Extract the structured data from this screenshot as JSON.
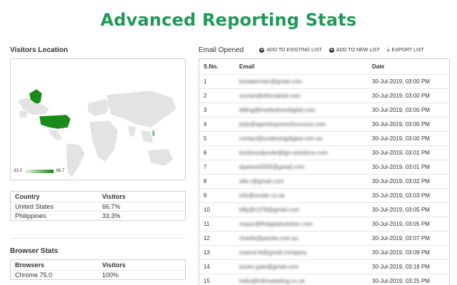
{
  "title": "Advanced Reporting Stats",
  "visitors_location": {
    "heading": "Visitors Location",
    "legend_min": "33.3",
    "legend_max": "66.7",
    "highlight_color": "#1a8a1a"
  },
  "country_table": {
    "headers": [
      "Country",
      "Visitors"
    ],
    "rows": [
      [
        "United States",
        "66.7%"
      ],
      [
        "Philippines",
        "33.3%"
      ]
    ]
  },
  "browser_stats": {
    "heading": "Browser Stats",
    "headers": [
      "Browsers",
      "Visitors"
    ],
    "rows": [
      [
        "Chrome 75.0",
        "100%"
      ]
    ]
  },
  "email_opened": {
    "heading": "Email Opened",
    "actions": [
      "ADD TO EXISTING LIST",
      "ADD TO NEW LIST",
      "EXPORT LIST"
    ],
    "headers": [
      "S.No.",
      "Email",
      "Date"
    ],
    "rows": [
      [
        "1",
        "kowaterman@gmail.com",
        "30-Jul-2019, 03:00 PM"
      ],
      [
        "2",
        "suvran@ethicalead.com",
        "30-Jul-2019, 03:00 PM"
      ],
      [
        "3",
        "billing@insidedivesdigital.com",
        "30-Jul-2019, 03:00 PM"
      ],
      [
        "4",
        "jody@agentexpress2success.com",
        "30-Jul-2019, 03:00 PM"
      ],
      [
        "5",
        "contact@underdogdigital.com.au",
        "30-Jul-2019, 03:00 PM"
      ],
      [
        "6",
        "koolsooulpoole@ign-solutions.com",
        "30-Jul-2019, 03:01 PM"
      ],
      [
        "7",
        "dpalmer0000@gmail.com",
        "30-Jul-2019, 03:01 PM"
      ],
      [
        "8",
        "atle.r@gmail.com",
        "30-Jul-2019, 03:02 PM"
      ],
      [
        "9",
        "info@onsite.co.uk",
        "30-Jul-2019, 03:03 PM"
      ],
      [
        "10",
        "billy@1378@gmail.com",
        "30-Jul-2019, 03:05 PM"
      ],
      [
        "11",
        "mayur@fhdigitalsolution.com",
        "30-Jul-2019, 03:05 PM"
      ],
      [
        "12",
        "charlie@panda.com.au",
        "30-Jul-2019, 03:07 PM"
      ],
      [
        "13",
        "osama.fe@gmail.company",
        "30-Jul-2019, 03:09 PM"
      ],
      [
        "14",
        "lucien.gate@gmail.com",
        "30-Jul-2019, 03:18 PM"
      ],
      [
        "15",
        "hello@fullmarketing.co.uk",
        "30-Jul-2019, 03:25 PM"
      ]
    ]
  }
}
